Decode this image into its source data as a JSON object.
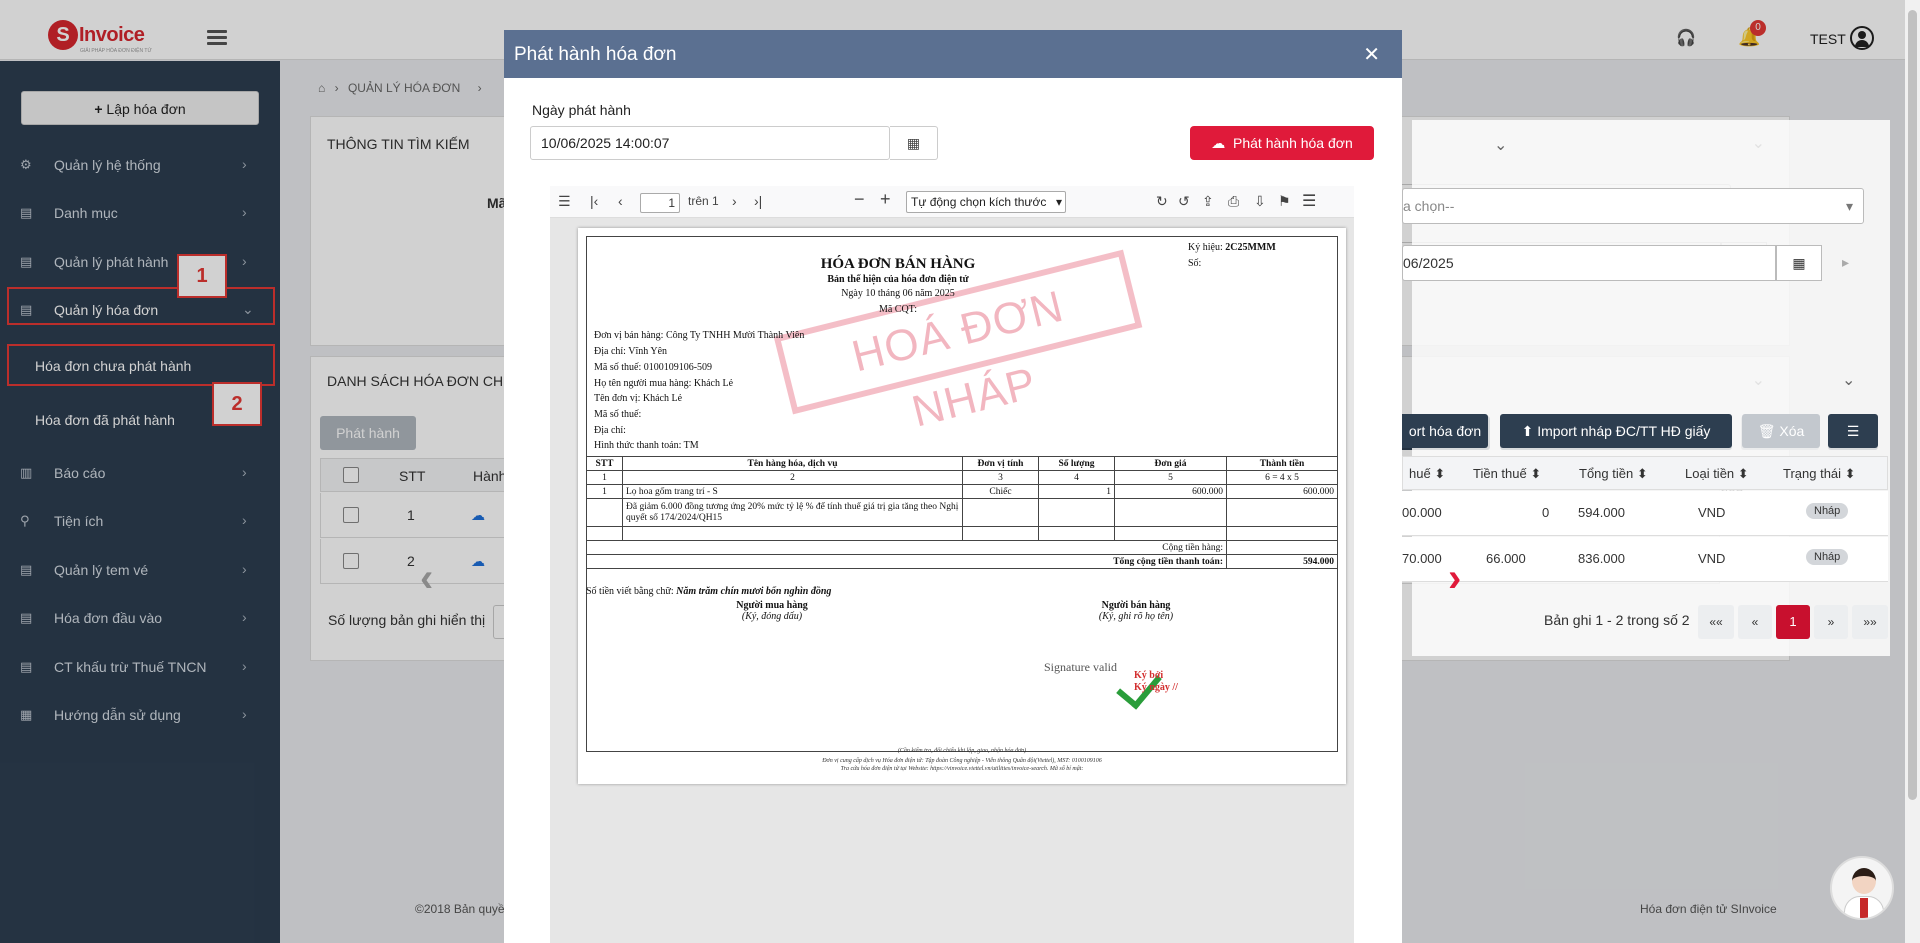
{
  "header": {
    "logo_letter": "S",
    "logo_text": "Invoice",
    "logo_sub": "GIẢI PHÁP HÓA ĐƠN ĐIỆN TỬ",
    "notification_count": "0",
    "username": "TEST"
  },
  "sidebar": {
    "create_button": "Lập hóa đơn",
    "items": [
      {
        "label": "Quản lý hệ thống"
      },
      {
        "label": "Danh mục"
      },
      {
        "label": "Quản lý phát hành"
      },
      {
        "label": "Quản lý hóa đơn"
      },
      {
        "label": "Báo cáo"
      },
      {
        "label": "Tiện ích"
      },
      {
        "label": "Quản lý tem vé"
      },
      {
        "label": "Hóa đơn đầu vào"
      },
      {
        "label": "CT khấu trừ Thuế TNCN"
      },
      {
        "label": "Hướng dẫn sử dụng"
      }
    ],
    "sub_items": [
      {
        "label": "Hóa đơn chưa phát hành"
      },
      {
        "label": "Hóa đơn đã phát hành"
      }
    ],
    "annotation_1": "1",
    "annotation_2": "2"
  },
  "main": {
    "breadcrumb": "QUẢN LÝ HÓA ĐƠN",
    "search_panel_title": "THÔNG TIN TÌM KIẾM",
    "search_label_partial": "Mã",
    "select_placeholder": "a chọn--",
    "date_partial": "06/2025",
    "list_panel_title": "DANH SÁCH HÓA ĐƠN CHƯ",
    "btn_issue": "Phát hành",
    "btn_export": "ort hóa đơn",
    "btn_import": "Import nháp ĐC/TT HĐ giấy",
    "btn_delete": "Xóa",
    "columns": {
      "stt": "STT",
      "action": "Hành",
      "tax_partial": "huế",
      "tax_amount": "Tiền thuế",
      "total": "Tổng tiền",
      "currency": "Loại tiền",
      "status": "Trạng thái"
    },
    "rows": [
      {
        "stt": "1",
        "pre_tax": "00.000",
        "tax": "0",
        "total": "594.000",
        "currency": "VND",
        "status": "Nháp"
      },
      {
        "stt": "2",
        "pre_tax": "70.000",
        "tax": "66.000",
        "total": "836.000",
        "currency": "VND",
        "status": "Nháp"
      }
    ],
    "page_size_label": "Số lượng bản ghi hiển thị",
    "record_info": "Bản ghi 1 - 2 trong số 2",
    "pager": {
      "first": "««",
      "prev": "«",
      "current": "1",
      "next": "»",
      "last": "»»"
    },
    "footer_left": "©2018 Bản quyề",
    "footer_right": "Hóa đơn điện tử SInvoice"
  },
  "modal": {
    "title": "Phát hành hóa đơn",
    "date_label": "Ngày phát hành",
    "date_value": "10/06/2025 14:00:07",
    "issue_button": "Phát hành hóa đơn",
    "viewer": {
      "page_current": "1",
      "page_total": "trên 1",
      "zoom": "Tự động chọn kích thước"
    },
    "invoice": {
      "title": "HÓA ĐƠN BÁN HÀNG",
      "subtitle": "Bản thể hiện của hóa đơn điện tử",
      "date_line": "Ngày 10 tháng 06 năm 2025",
      "cqt": "Mã CQT:",
      "symbol_label": "Ký hiệu:",
      "symbol_value": "2C25MMM",
      "number_label": "Số:",
      "stamp": "HOÁ ĐƠN NHÁP",
      "seller": "Đơn vị bán hàng: Công Ty TNHH Mười Thành Viên",
      "address": "Địa chỉ: Vĩnh Yên",
      "tax_code": "Mã số thuế: 0100109106-509",
      "buyer_name": "Họ tên người mua hàng: Khách Lẻ",
      "buyer_unit": "Tên đơn vị: Khách Lẻ",
      "buyer_tax": "Mã số thuế:",
      "buyer_address": "Địa chỉ:",
      "payment": "Hình thức thanh toán: TM",
      "table_head": [
        "STT",
        "Tên hàng hóa, dịch vụ",
        "Đơn vị tính",
        "Số lượng",
        "Đơn giá",
        "Thành tiền"
      ],
      "table_idx": [
        "1",
        "2",
        "3",
        "4",
        "5",
        "6 = 4 x 5"
      ],
      "item_stt": "1",
      "item_name": "Lọ hoa gốm trang trí - S",
      "item_unit": "Chiếc",
      "item_qty": "1",
      "item_price": "600.000",
      "item_amount": "600.000",
      "discount_note": "Đã giảm 6.000 đồng tương ứng 20% mức tỷ lệ % để tính thuế giá trị gia tăng theo Nghị quyết số 174/2024/QH15",
      "subtotal_label": "Cộng tiền hàng:",
      "grand_label": "Tổng cộng tiền thanh toán:",
      "grand_value": "594.000",
      "words": "Số tiền viết bằng chữ:",
      "words_value": "Năm trăm chín mươi bốn nghìn đồng",
      "buyer_sig": "Người mua hàng",
      "buyer_sig_note": "(Ký, đóng dấu)",
      "seller_sig": "Người bán hàng",
      "seller_sig_note": "(Ký, ghi rõ họ tên)",
      "sig_valid": "Signature valid",
      "sig_red_1": "Ký bởi",
      "sig_red_2": "Ký ngày //",
      "foot_1": "(Cần kiểm tra, đối chiếu khi lập, giao, nhận hóa đơn)",
      "foot_2": "Đơn vị cung cấp dịch vụ Hóa đơn điện tử: Tập đoàn Công nghiệp - Viễn thông Quân đội(Viettel), MST: 0100109106",
      "foot_3": "Tra cứu hóa đơn điện tử tại Website: https://vinvoice.viettel.vn/utilities/invoice-search. Mã số bí mật:"
    }
  }
}
